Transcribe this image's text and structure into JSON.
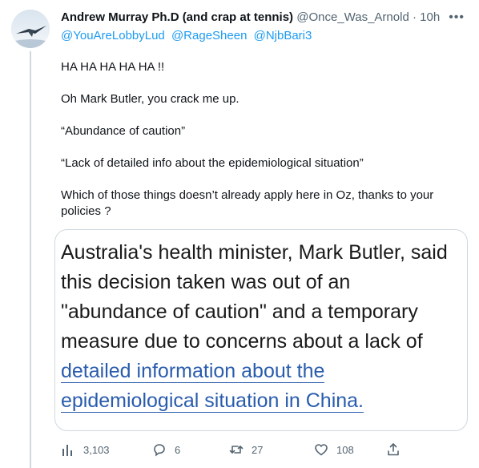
{
  "tweet": {
    "author_name": "Andrew Murray Ph.D (and crap at tennis)",
    "author_handle": "@Once_Was_Arnold",
    "separator": "·",
    "time": "10h",
    "more_label": "•••",
    "replying_to": [
      "@YouAreLobbyLud",
      "@RageSheen",
      "@NjbBari3"
    ],
    "paragraphs": [
      "HA HA HA HA HA !!",
      "Oh Mark Butler, you crack me up.",
      "“Abundance of caution”",
      "“Lack of detailed info about the epidemiological situation”",
      "Which of those things doesn’t already apply here in Oz, thanks to your policies ?"
    ]
  },
  "quote_image": {
    "text_plain": "Australia's health minister, Mark Butler, said this decision taken was out of an \"abundance of caution\" and a temporary measure due to concerns about a lack of",
    "text_link": "detailed information about the epidemiological situation in China."
  },
  "actions": {
    "views": "3,103",
    "replies": "6",
    "retweets": "27",
    "likes": "108"
  },
  "icons": {
    "views": "bar-chart-icon",
    "reply": "comment-bubble-icon",
    "retweet": "retweet-arrows-icon",
    "like": "heart-icon",
    "share": "share-upload-icon",
    "more": "more-dots-icon"
  },
  "colors": {
    "link": "#1d9bf0",
    "secondary_text": "#536471",
    "quote_link": "#2a5cad"
  }
}
